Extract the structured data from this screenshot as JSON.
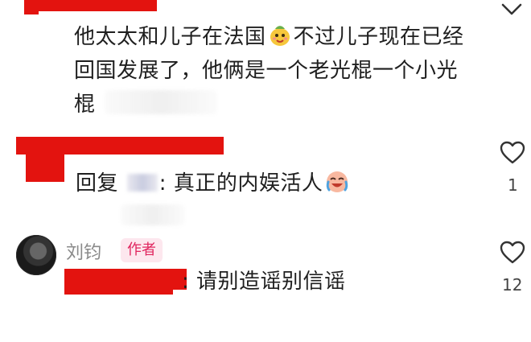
{
  "comment1": {
    "line1_a": "他太太和儿子在法国",
    "line1_b": "不过儿子现在已经",
    "line2": "回国发展了，他俩是一个老光棍一个小光",
    "line3": "棍",
    "emoji": "melon-face-emoji"
  },
  "comment2": {
    "reply_prefix": "回复",
    "reply_colon": ":",
    "reply_text": "真正的内娱活人",
    "emoji": "laughing-crying-face-emoji",
    "like_count": "1"
  },
  "comment3": {
    "author_name": "刘钧",
    "author_badge": "作者",
    "text": ": 请别造谣别信谣",
    "like_count": "12"
  },
  "icons": {
    "collapse": "chevron-down-icon",
    "like": "heart-outline-icon"
  },
  "colors": {
    "redaction": "#e3130f",
    "badge_text": "#e0245e",
    "badge_bg": "#fde7ee"
  }
}
